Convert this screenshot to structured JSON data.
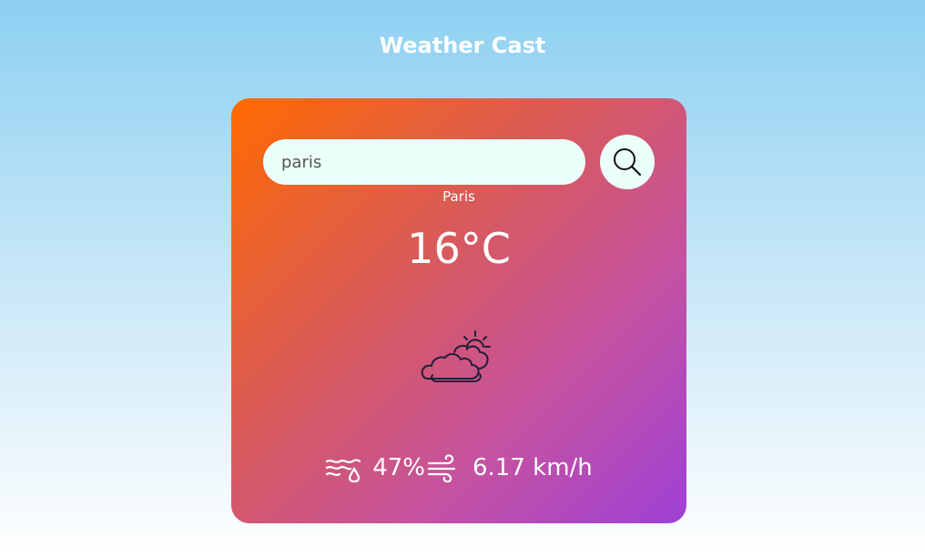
{
  "app": {
    "title": "Weather Cast"
  },
  "search": {
    "value": "paris",
    "button_icon": "search-icon"
  },
  "weather": {
    "city": "Paris",
    "temperature": "16°C",
    "condition_icon": "partly-cloudy-icon",
    "humidity": "47%",
    "humidity_icon": "humidity-icon",
    "wind_speed": "6.17 km/h",
    "wind_icon": "wind-icon"
  },
  "colors": {
    "card_gradient_start": "#ff6a00",
    "card_gradient_end": "#9e40d6",
    "input_background": "#ebfffb",
    "icon_stroke": "#1f1f3a",
    "text": "#ffffff"
  }
}
